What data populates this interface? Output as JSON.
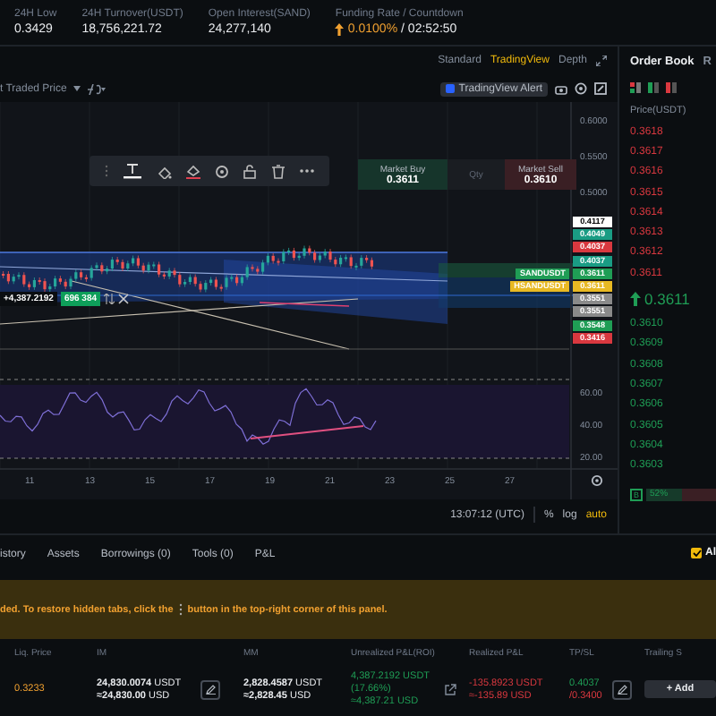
{
  "stats": [
    {
      "label": "24H Low",
      "value": "0.3429"
    },
    {
      "label": "24H Turnover(USDT)",
      "value": "18,756,221.72"
    },
    {
      "label": "Open Interest(SAND)",
      "value": "24,277,140"
    },
    {
      "label": "Funding Rate / Countdown",
      "value": "0.0100%",
      "extra": "/ 02:52:50"
    }
  ],
  "chart": {
    "views": [
      {
        "label": "Standard",
        "selected": false
      },
      {
        "label": "TradingView",
        "selected": true
      },
      {
        "label": "Depth",
        "selected": false
      }
    ],
    "price_source": "t Traded Price",
    "alert_button": "TradingView Alert",
    "market_buy": {
      "label": "Market Buy",
      "price": "0.3611"
    },
    "qty_placeholder": "Qty",
    "market_sell": {
      "label": "Market Sell",
      "price": "0.3610"
    },
    "price_ticks": [
      "0.6000",
      "0.5500",
      "0.5000"
    ],
    "price_tags": [
      {
        "text": "0.4117",
        "color": "#ffffff"
      },
      {
        "text": "0.4049",
        "color": "#1a9c84"
      },
      {
        "text": "0.4037",
        "color": "#d9383f"
      },
      {
        "text": "0.4037",
        "color": "#1a9c84"
      },
      {
        "text": "0.3611",
        "color": "#1f9d55"
      },
      {
        "text": "0.3611",
        "color": "#e8b923"
      },
      {
        "text": "0.3551",
        "color": "#8a8a8a"
      },
      {
        "text": "0.3551",
        "color": "#8a8a8a"
      },
      {
        "text": "0.3548",
        "color": "#1f9d55"
      },
      {
        "text": "0.3416",
        "color": "#d9383f"
      }
    ],
    "symbol_tags": [
      {
        "text": "SANDUSDT",
        "color": "#1f9d55"
      },
      {
        "text": "HSANDUSDT",
        "color": "#e8b923"
      }
    ],
    "position_pnl": "+4,387.2192",
    "position_size": "696 384",
    "rsi_ticks": [
      "60.00",
      "40.00",
      "20.00"
    ],
    "x_ticks": [
      "11",
      "13",
      "15",
      "17",
      "19",
      "21",
      "23",
      "25",
      "27"
    ],
    "time": "13:07:12 (UTC)",
    "scales": [
      {
        "label": "%",
        "selected": false
      },
      {
        "label": "log",
        "selected": false
      },
      {
        "label": "auto",
        "selected": true
      }
    ]
  },
  "order_book": {
    "title": "Order Book",
    "next_tab": "R",
    "price_header": "Price(USDT)",
    "asks": [
      "0.3618",
      "0.3617",
      "0.3616",
      "0.3615",
      "0.3614",
      "0.3613",
      "0.3612",
      "0.3611"
    ],
    "last_price": "0.3611",
    "bids": [
      "0.3610",
      "0.3609",
      "0.3608",
      "0.3607",
      "0.3606",
      "0.3605",
      "0.3604",
      "0.3603"
    ],
    "buy_label": "B",
    "buy_ratio": "52%",
    "level": 0.52
  },
  "bottom": {
    "tabs": [
      "istory",
      "Assets",
      "Borrowings (0)",
      "Tools (0)",
      "P&L"
    ],
    "all_checkbox": {
      "label": "Al",
      "checked": true
    },
    "notice_before": "ded. To restore hidden tabs, click the",
    "notice_after": "button in the top-right corner of this panel.",
    "columns": [
      "Liq. Price",
      "IM",
      "MM",
      "Unrealized P&L(ROI)",
      "Realized P&L",
      "TP/SL",
      "Trailing S"
    ],
    "row": {
      "liq_price": "0.3233",
      "im": [
        "**24,830.0074** USDT",
        "**≈24,830.00** USD"
      ],
      "mm": [
        "**2,828.4587** USDT",
        "**≈2,828.45** USD"
      ],
      "unrealized": [
        "4,387.2192 USDT",
        "(17.66%)",
        "≈4,387.21 USD"
      ],
      "realized": [
        "-135.8923 USDT",
        "≈-135.89 USD"
      ],
      "tp": "0.4037",
      "sl": "/0.3400",
      "add_button": "+ Add"
    }
  }
}
